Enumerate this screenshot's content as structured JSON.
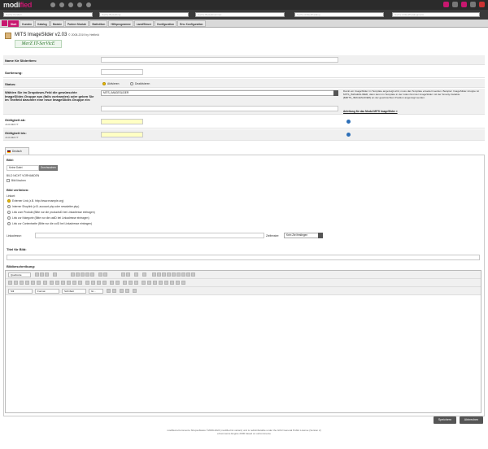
{
  "app": {
    "logo_prefix": "modi",
    "logo_suffix": "fied"
  },
  "search": {
    "p1": "Suche Kunden",
    "p2": "Suche Bestellung",
    "p3": "Suche Bestellnummer",
    "p4": "Suche Artikel/Katalog",
    "p5": "Suche Artikel/Katalogmenü"
  },
  "nav": [
    "Start",
    "Kunden",
    "Katalog",
    "Module",
    "Partner Module",
    "Statistiken",
    "Hilfsprogramme",
    "Land/Steuer",
    "Konfiguration",
    "Erw. Konfiguration"
  ],
  "header": {
    "title": "MITS ImageSlider v2.03",
    "copyright": "© 2008-2019 by Hetfield",
    "brand": "MerZ IT-SerVicE"
  },
  "form": {
    "name_label": "Name für Slideritem:",
    "sort_label": "Sortierung:",
    "status_label": "Status:",
    "status_on": "Aktivieren",
    "status_off": "Deaktivieren",
    "group_label": "Wählen Sie im Dropdown-Feld die gewünschte ImageSlider-Gruppe aus (falls vorhanden) oder geben Sie im Textfeld darunter eine neue ImageSlider-Gruppe ein:",
    "group_value": "MITS_IMAGESLIDER",
    "group_note": "Damit ein ImageSlider im Template angezeigt wird, muss das Template erweitert werden. Beispiel: ImageSlider-Gruppe ist MITS_IMAGESLIDER, dann kann im Template in der index.html der ImageSlider mit der Smarty-Variable {$MITS_IMAGESLIDER} an der gewünschten Position angezeigt werden.",
    "guide_link": "Anleitung für das Modul MITS ImageSlider »",
    "valid_from": "Gültigkeit ab:",
    "valid_from_fmt": "JJJJ-MM-TT",
    "valid_to": "Gültigkeit bis:",
    "valid_to_fmt": "JJJJ-MM-TT"
  },
  "tab": {
    "label": "Deutsch"
  },
  "image": {
    "label": "Bild:",
    "choose_placeholder": "Keine Datei",
    "browse": "Durchsuchen",
    "none": "BILD NICHT VORHANDEN",
    "delete": "Bild löschen"
  },
  "link": {
    "label": "Bild verlinken:",
    "sub": "Linkart:",
    "options": [
      "Externer Link (z.B. http://www.example.org)",
      "Interner Shoplink (z.B. account.php oder newsletter.php)",
      "Link zum Produkt (Bitte nur die productsID bei Linkadresse eintragen)",
      "Link zur Kategorie (Bitte nur die catID bei Linkadresse eintragen)",
      "Link zur Contentseite (Bitte nur die coID bei Linkadresse eintragen)"
    ],
    "address_label": "Linkadresse:",
    "target_label": "Zielfenster:",
    "target_value": "Kein Ziel festlegen"
  },
  "title_label": "Titel für Bild:",
  "desc_label": "Bildbeschreibung:",
  "editor": {
    "source": "Quellcode",
    "style": "Stil",
    "format": "Format",
    "font": "Schriftart",
    "size": "Gr..."
  },
  "buttons": {
    "save": "Speichern",
    "cancel": "Abbrechen"
  },
  "footer": {
    "line1": "modified eCommerce Shopsoftware ©2009-2024 (modified ist variant) und is redistributable under the GNU General Public License (Version 2)",
    "line2": "eCommerce Engine 2006 based on osCommerce"
  },
  "colors": {
    "accent": "#c8176f",
    "topbar": "#2b2b2b",
    "highlight": "#ffffc4"
  }
}
